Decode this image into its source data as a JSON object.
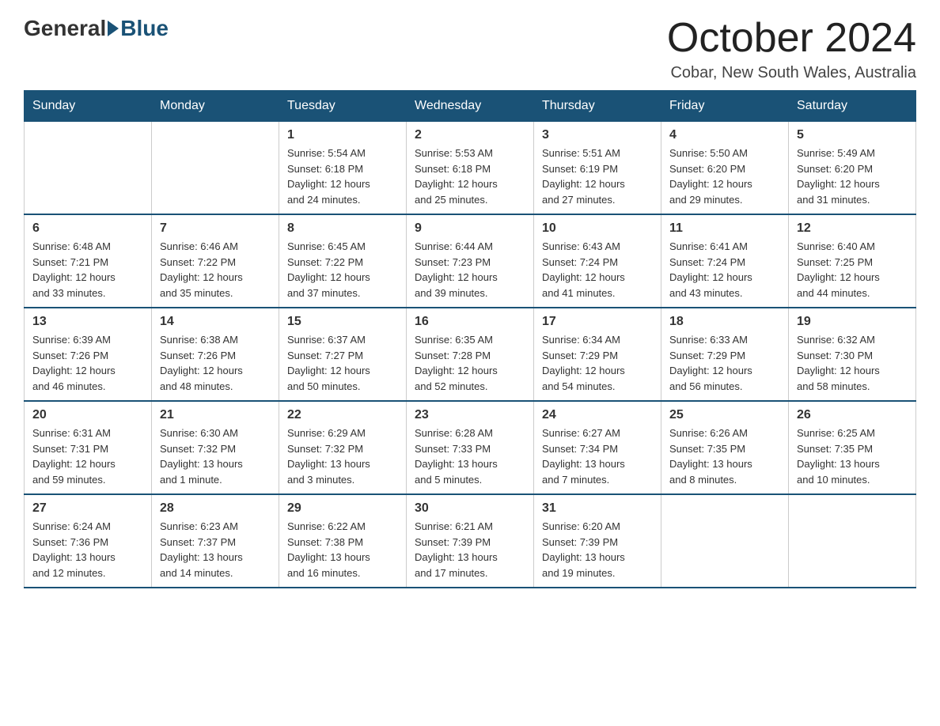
{
  "header": {
    "logo_general": "General",
    "logo_blue": "Blue",
    "month_title": "October 2024",
    "location": "Cobar, New South Wales, Australia"
  },
  "weekdays": [
    "Sunday",
    "Monday",
    "Tuesday",
    "Wednesday",
    "Thursday",
    "Friday",
    "Saturday"
  ],
  "weeks": [
    [
      {
        "day": "",
        "info": ""
      },
      {
        "day": "",
        "info": ""
      },
      {
        "day": "1",
        "info": "Sunrise: 5:54 AM\nSunset: 6:18 PM\nDaylight: 12 hours\nand 24 minutes."
      },
      {
        "day": "2",
        "info": "Sunrise: 5:53 AM\nSunset: 6:18 PM\nDaylight: 12 hours\nand 25 minutes."
      },
      {
        "day": "3",
        "info": "Sunrise: 5:51 AM\nSunset: 6:19 PM\nDaylight: 12 hours\nand 27 minutes."
      },
      {
        "day": "4",
        "info": "Sunrise: 5:50 AM\nSunset: 6:20 PM\nDaylight: 12 hours\nand 29 minutes."
      },
      {
        "day": "5",
        "info": "Sunrise: 5:49 AM\nSunset: 6:20 PM\nDaylight: 12 hours\nand 31 minutes."
      }
    ],
    [
      {
        "day": "6",
        "info": "Sunrise: 6:48 AM\nSunset: 7:21 PM\nDaylight: 12 hours\nand 33 minutes."
      },
      {
        "day": "7",
        "info": "Sunrise: 6:46 AM\nSunset: 7:22 PM\nDaylight: 12 hours\nand 35 minutes."
      },
      {
        "day": "8",
        "info": "Sunrise: 6:45 AM\nSunset: 7:22 PM\nDaylight: 12 hours\nand 37 minutes."
      },
      {
        "day": "9",
        "info": "Sunrise: 6:44 AM\nSunset: 7:23 PM\nDaylight: 12 hours\nand 39 minutes."
      },
      {
        "day": "10",
        "info": "Sunrise: 6:43 AM\nSunset: 7:24 PM\nDaylight: 12 hours\nand 41 minutes."
      },
      {
        "day": "11",
        "info": "Sunrise: 6:41 AM\nSunset: 7:24 PM\nDaylight: 12 hours\nand 43 minutes."
      },
      {
        "day": "12",
        "info": "Sunrise: 6:40 AM\nSunset: 7:25 PM\nDaylight: 12 hours\nand 44 minutes."
      }
    ],
    [
      {
        "day": "13",
        "info": "Sunrise: 6:39 AM\nSunset: 7:26 PM\nDaylight: 12 hours\nand 46 minutes."
      },
      {
        "day": "14",
        "info": "Sunrise: 6:38 AM\nSunset: 7:26 PM\nDaylight: 12 hours\nand 48 minutes."
      },
      {
        "day": "15",
        "info": "Sunrise: 6:37 AM\nSunset: 7:27 PM\nDaylight: 12 hours\nand 50 minutes."
      },
      {
        "day": "16",
        "info": "Sunrise: 6:35 AM\nSunset: 7:28 PM\nDaylight: 12 hours\nand 52 minutes."
      },
      {
        "day": "17",
        "info": "Sunrise: 6:34 AM\nSunset: 7:29 PM\nDaylight: 12 hours\nand 54 minutes."
      },
      {
        "day": "18",
        "info": "Sunrise: 6:33 AM\nSunset: 7:29 PM\nDaylight: 12 hours\nand 56 minutes."
      },
      {
        "day": "19",
        "info": "Sunrise: 6:32 AM\nSunset: 7:30 PM\nDaylight: 12 hours\nand 58 minutes."
      }
    ],
    [
      {
        "day": "20",
        "info": "Sunrise: 6:31 AM\nSunset: 7:31 PM\nDaylight: 12 hours\nand 59 minutes."
      },
      {
        "day": "21",
        "info": "Sunrise: 6:30 AM\nSunset: 7:32 PM\nDaylight: 13 hours\nand 1 minute."
      },
      {
        "day": "22",
        "info": "Sunrise: 6:29 AM\nSunset: 7:32 PM\nDaylight: 13 hours\nand 3 minutes."
      },
      {
        "day": "23",
        "info": "Sunrise: 6:28 AM\nSunset: 7:33 PM\nDaylight: 13 hours\nand 5 minutes."
      },
      {
        "day": "24",
        "info": "Sunrise: 6:27 AM\nSunset: 7:34 PM\nDaylight: 13 hours\nand 7 minutes."
      },
      {
        "day": "25",
        "info": "Sunrise: 6:26 AM\nSunset: 7:35 PM\nDaylight: 13 hours\nand 8 minutes."
      },
      {
        "day": "26",
        "info": "Sunrise: 6:25 AM\nSunset: 7:35 PM\nDaylight: 13 hours\nand 10 minutes."
      }
    ],
    [
      {
        "day": "27",
        "info": "Sunrise: 6:24 AM\nSunset: 7:36 PM\nDaylight: 13 hours\nand 12 minutes."
      },
      {
        "day": "28",
        "info": "Sunrise: 6:23 AM\nSunset: 7:37 PM\nDaylight: 13 hours\nand 14 minutes."
      },
      {
        "day": "29",
        "info": "Sunrise: 6:22 AM\nSunset: 7:38 PM\nDaylight: 13 hours\nand 16 minutes."
      },
      {
        "day": "30",
        "info": "Sunrise: 6:21 AM\nSunset: 7:39 PM\nDaylight: 13 hours\nand 17 minutes."
      },
      {
        "day": "31",
        "info": "Sunrise: 6:20 AM\nSunset: 7:39 PM\nDaylight: 13 hours\nand 19 minutes."
      },
      {
        "day": "",
        "info": ""
      },
      {
        "day": "",
        "info": ""
      }
    ]
  ]
}
